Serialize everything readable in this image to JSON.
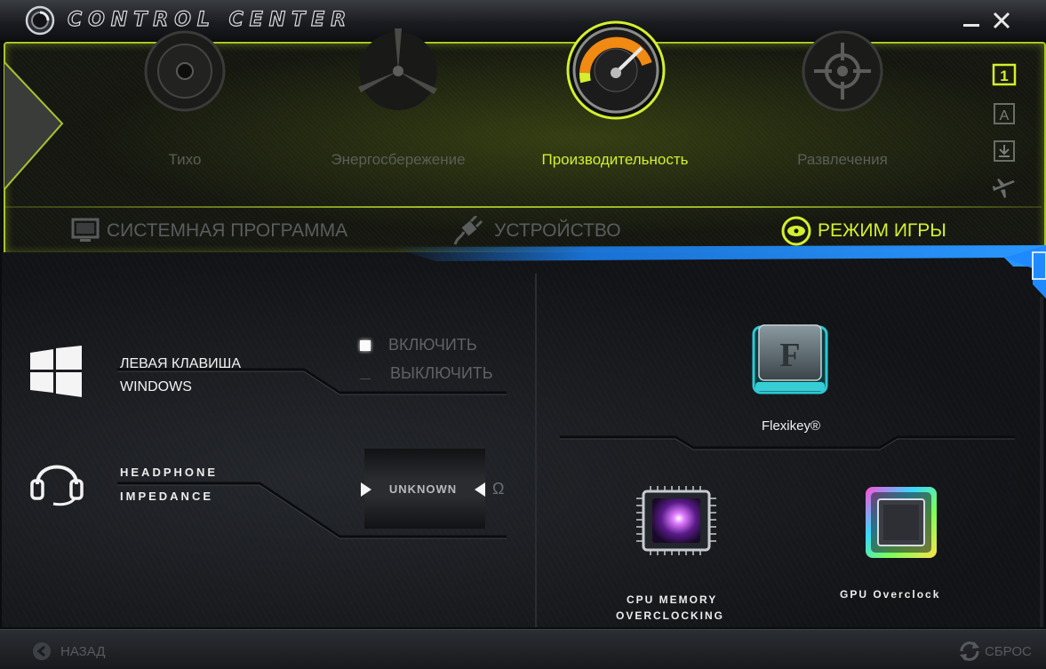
{
  "window": {
    "title": "CONTROL CENTER"
  },
  "modes": [
    {
      "label": "Тихо",
      "active": false
    },
    {
      "label": "Энергосбережение",
      "active": false
    },
    {
      "label": "Производительность",
      "active": true
    },
    {
      "label": "Развлечения",
      "active": false
    }
  ],
  "side_icons": {
    "profile_1": "1",
    "profile_a": "A"
  },
  "tabs": [
    {
      "label": "СИСТЕМНАЯ ПРОГРАММА",
      "active": false
    },
    {
      "label": "УСТРОЙСТВО",
      "active": false
    },
    {
      "label": "РЕЖИМ ИГРЫ",
      "active": true
    }
  ],
  "windows_key": {
    "label_line1": "ЛЕВАЯ КЛАВИША",
    "label_line2": "WINDOWS",
    "enable_label": "ВКЛЮЧИТЬ",
    "disable_label": "ВЫКЛЮЧИТЬ",
    "selected": "enable"
  },
  "headphone": {
    "label_line1": "HEADPHONE",
    "label_line2": "IMPEDANCE",
    "value": "UNKNOWN",
    "unit": "Ω"
  },
  "features": {
    "flexikey_label": "Flexikey®",
    "cpu_label_line1": "CPU MEMORY",
    "cpu_label_line2": "OVERCLOCKING",
    "gpu_label": "GPU Overclock"
  },
  "bottom": {
    "back_label": "НАЗАД",
    "reset_label": "СБРОС"
  },
  "colors": {
    "accent": "#d4ef2e",
    "inactive_text": "#5b5d58",
    "panel_border": "#a9c52a"
  }
}
